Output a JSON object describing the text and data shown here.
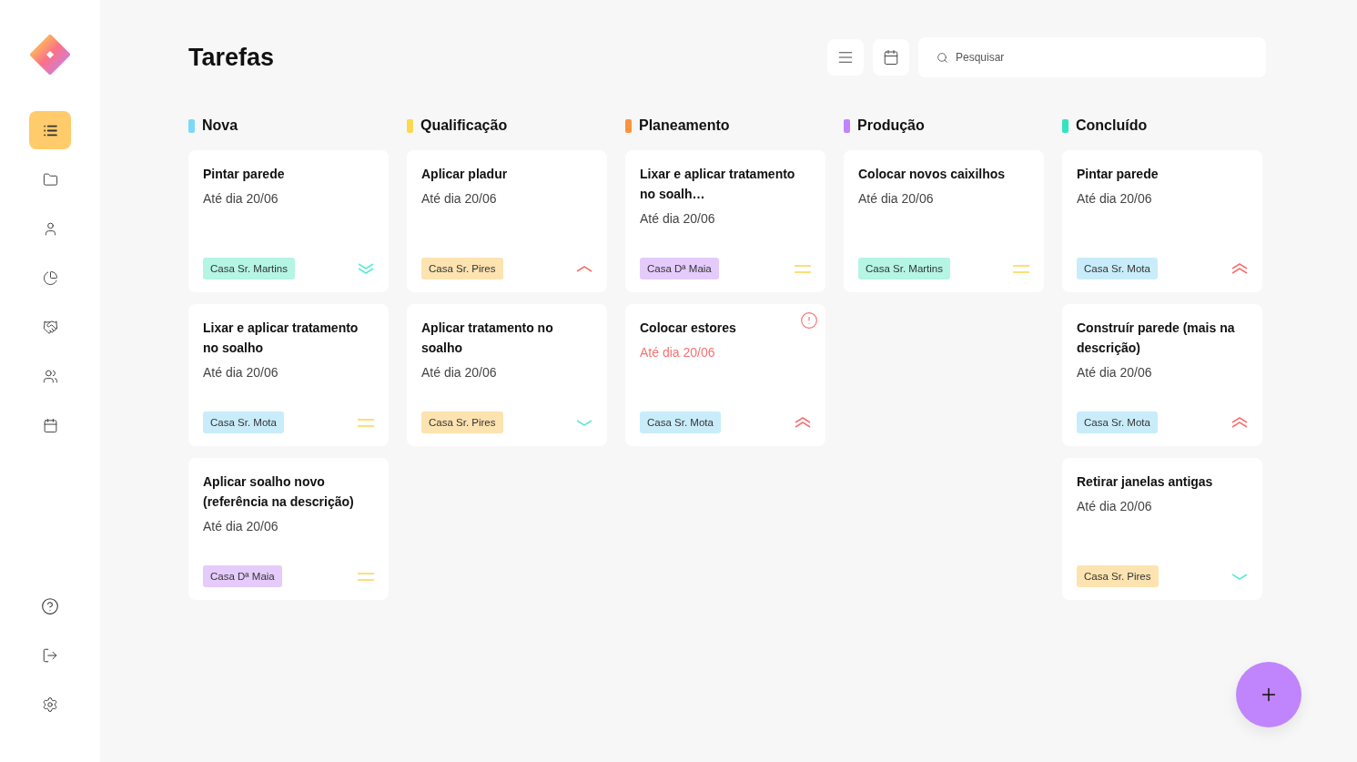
{
  "sidebar": {
    "nav": [
      {
        "selected": true
      },
      {
        "selected": false
      },
      {
        "selected": false
      },
      {
        "selected": false
      },
      {
        "selected": false
      },
      {
        "selected": false
      },
      {
        "selected": false
      }
    ]
  },
  "header": {
    "title": "Tarefas",
    "search": {
      "placeholder": "Pesquisar"
    }
  },
  "columns": [
    {
      "name": "Nova",
      "color": "#7dd8f7",
      "cards": [
        {
          "title": "Pintar parede",
          "date": "Até dia 20/06",
          "overdue": false,
          "tag": {
            "label": "Casa Sr. Martins",
            "color": "#b4f5e4"
          },
          "priority": {
            "kind": "lowest"
          }
        },
        {
          "title": "Lixar e aplicar tratamento no soalho",
          "date": "Até dia 20/06",
          "overdue": false,
          "tag": {
            "label": "Casa Sr. Mota",
            "color": "#c9ecfb"
          },
          "priority": {
            "kind": "medium"
          }
        },
        {
          "title": "Aplicar soalho novo (referência na descrição)",
          "date": "Até dia 20/06",
          "overdue": false,
          "tag": {
            "label": "Casa Dª Maia",
            "color": "#e5cbfb"
          },
          "priority": {
            "kind": "medium"
          }
        }
      ]
    },
    {
      "name": "Qualificação",
      "color": "#fcd94f",
      "cards": [
        {
          "title": "Aplicar pladur",
          "date": "Até dia 20/06",
          "overdue": false,
          "tag": {
            "label": "Casa Sr. Pires",
            "color": "#fde3b0"
          },
          "priority": {
            "kind": "high"
          }
        },
        {
          "title": "Aplicar tratamento no soalho",
          "date": "Até dia 20/06",
          "overdue": false,
          "tag": {
            "label": "Casa Sr. Pires",
            "color": "#fde3b0"
          },
          "priority": {
            "kind": "low"
          }
        }
      ]
    },
    {
      "name": "Planeamento",
      "color": "#fb923c",
      "cards": [
        {
          "title": "Lixar e  aplicar tratamento no soalh…",
          "date": "Até dia 20/06",
          "overdue": false,
          "tag": {
            "label": "Casa Dª Maia",
            "color": "#e5cbfb"
          },
          "priority": {
            "kind": "medium"
          }
        },
        {
          "title": "Colocar estores",
          "date": "Até dia 20/06",
          "overdue": true,
          "tag": {
            "label": "Casa Sr. Mota",
            "color": "#c9ecfb"
          },
          "priority": {
            "kind": "highest"
          }
        }
      ]
    },
    {
      "name": "Produção",
      "color": "#c084fc",
      "cards": [
        {
          "title": "Colocar novos caixilhos",
          "date": "Até dia 20/06",
          "overdue": false,
          "tag": {
            "label": "Casa Sr. Martins",
            "color": "#b4f5e4"
          },
          "priority": {
            "kind": "medium"
          }
        }
      ]
    },
    {
      "name": "Concluído",
      "color": "#34e3c0",
      "cards": [
        {
          "title": "Pintar parede",
          "date": "Até dia 20/06",
          "overdue": false,
          "tag": {
            "label": "Casa Sr. Mota",
            "color": "#c9ecfb"
          },
          "priority": {
            "kind": "highest"
          }
        },
        {
          "title": "Construír  parede (mais na descrição)",
          "date": "Até dia 20/06",
          "overdue": false,
          "tag": {
            "label": "Casa Sr. Mota",
            "color": "#c9ecfb"
          },
          "priority": {
            "kind": "highest"
          }
        },
        {
          "title": "Retirar janelas antigas",
          "date": "Até dia 20/06",
          "overdue": false,
          "tag": {
            "label": "Casa Sr. Pires",
            "color": "#fde3b0"
          },
          "priority": {
            "kind": "low"
          }
        }
      ]
    }
  ]
}
